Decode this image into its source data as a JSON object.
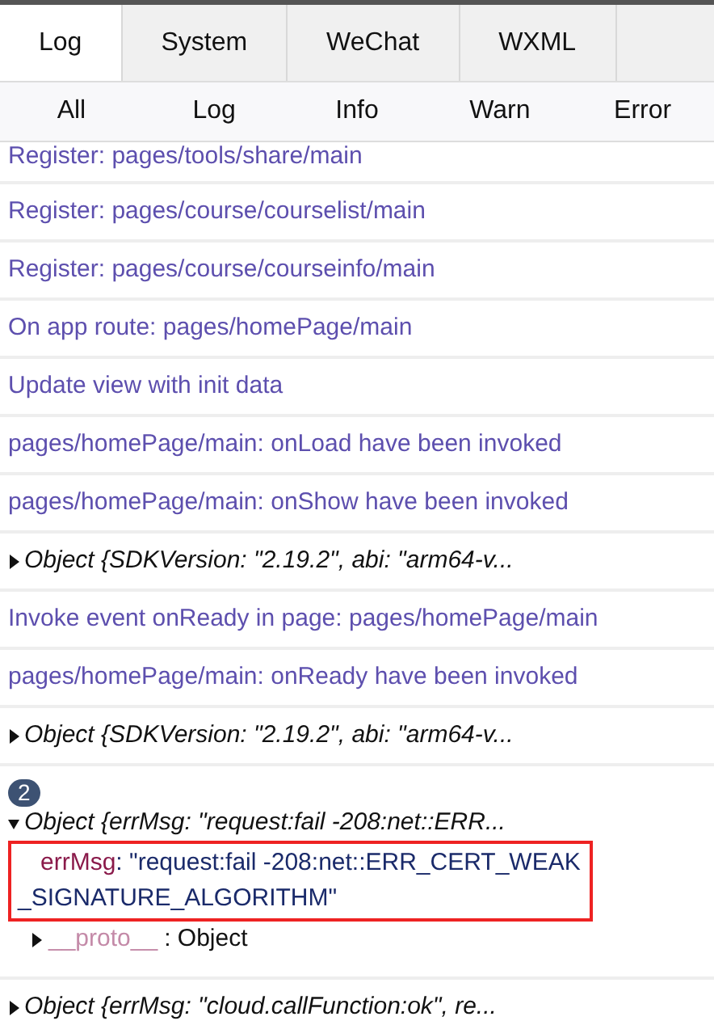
{
  "tabs": [
    {
      "label": "Log",
      "selected": true
    },
    {
      "label": "System",
      "selected": false
    },
    {
      "label": "WeChat",
      "selected": false
    },
    {
      "label": "WXML",
      "selected": false
    }
  ],
  "filters": [
    "All",
    "Log",
    "Info",
    "Warn",
    "Error"
  ],
  "entries": [
    {
      "kind": "text",
      "text": "Register: pages/tools/share/main"
    },
    {
      "kind": "text",
      "text": "Register: pages/course/courselist/main"
    },
    {
      "kind": "text",
      "text": "Register: pages/course/courseinfo/main"
    },
    {
      "kind": "text",
      "text": "On app route: pages/homePage/main"
    },
    {
      "kind": "text",
      "text": "Update view with init data"
    },
    {
      "kind": "text",
      "text": "pages/homePage/main: onLoad have been invoked"
    },
    {
      "kind": "text",
      "text": "pages/homePage/main: onShow have been invoked"
    },
    {
      "kind": "object",
      "text": "Object {SDKVersion: \"2.19.2\", abi: \"arm64-v...",
      "expanded": false
    },
    {
      "kind": "text",
      "text": "Invoke event onReady in page: pages/homePage/main"
    },
    {
      "kind": "text",
      "text": "pages/homePage/main: onReady have been invoked"
    },
    {
      "kind": "object",
      "text": "Object {SDKVersion: \"2.19.2\", abi: \"arm64-v...",
      "expanded": false
    },
    {
      "kind": "object",
      "count": "2",
      "text": "Object {errMsg: \"request:fail -208:net::ERR...",
      "expanded": true,
      "properties": [
        {
          "key": "errMsg",
          "separator": ":",
          "value": "\"request:fail -208:net::ERR_CERT_WEAK_SIGNATURE_ALGORITHM\"",
          "highlighted": true
        }
      ],
      "proto": {
        "key": "__proto__",
        "separator": ":",
        "value": "Object"
      }
    },
    {
      "kind": "object",
      "text": "Object {errMsg: \"cloud.callFunction:ok\", re...",
      "expanded": false
    }
  ]
}
